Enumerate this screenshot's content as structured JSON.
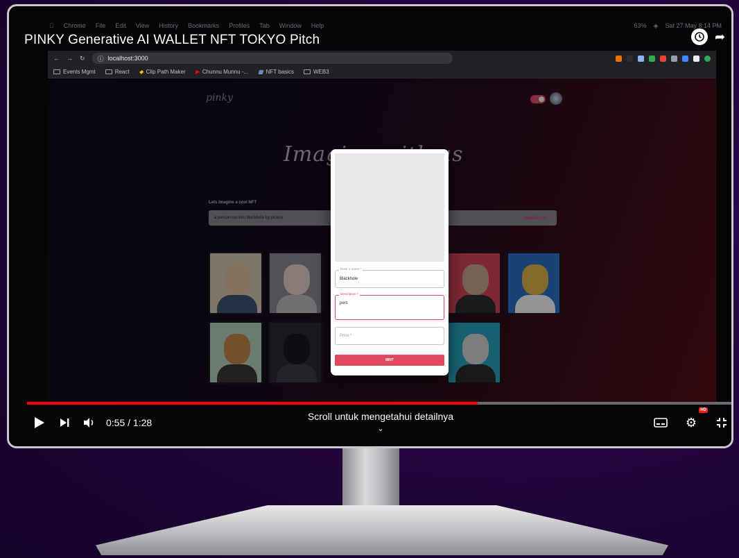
{
  "mac_menubar": {
    "items": [
      "Chrome",
      "File",
      "Edit",
      "View",
      "History",
      "Bookmarks",
      "Profiles",
      "Tab",
      "Window",
      "Help"
    ],
    "battery": "63%",
    "datetime": "Sat 27 May 8:14 PM"
  },
  "video": {
    "title": "PINKY Generative AI WALLET NFT TOKYO Pitch",
    "time": "0:55 / 1:28",
    "progress_fraction": 0.637,
    "chapter": "Scroll untuk mengetahui detailnya",
    "chevron": "⌄",
    "hd_badge": "HD"
  },
  "browser": {
    "url": "localhost:3000",
    "bookmarks": [
      "Events Mgmt",
      "React",
      "Clip Path Maker",
      "Chunnu Munnu -...",
      "NFT basics",
      "WEB3"
    ]
  },
  "page": {
    "logo": "pinky",
    "hero_text": "Imagine with us",
    "prompt_label": "Lets imagine a cool NFT",
    "prompt_value": "a person run into blackhole by picaso",
    "generate_label": "GENERATE"
  },
  "modal": {
    "name_label": "Enter a name *",
    "name_value": "Blackhole",
    "description_label": "Description *",
    "description_value": "pers",
    "price_placeholder": "Price *",
    "submit_label": "MINT"
  },
  "nfts": [
    {
      "bg": "#d9cbb4",
      "skin": "#e6c3a5",
      "cloth": "#3d5878"
    },
    {
      "bg": "#8f8c94",
      "skin": "#ecd6cf",
      "cloth": "#c4bfc4"
    },
    {
      "bg": "#d9455a",
      "skin": "#c7a98d",
      "cloth": "#2e2e33"
    },
    {
      "bg": "#2d73c9",
      "skin": "#e3b54a",
      "cloth": "#ffffff"
    },
    {
      "bg": "#b9d6c7",
      "skin": "#c9884d",
      "cloth": "#3a3a3c"
    },
    {
      "bg": "#2c2c36",
      "skin": "#1b1b21",
      "cloth": "#3d3d46"
    },
    {
      "bg": "#2aa7c4",
      "skin": "#d8d8dc",
      "cloth": "#2b2b30"
    }
  ],
  "colors": {
    "progress_red": "#ff0000",
    "accent_pink": "#e0485f"
  }
}
